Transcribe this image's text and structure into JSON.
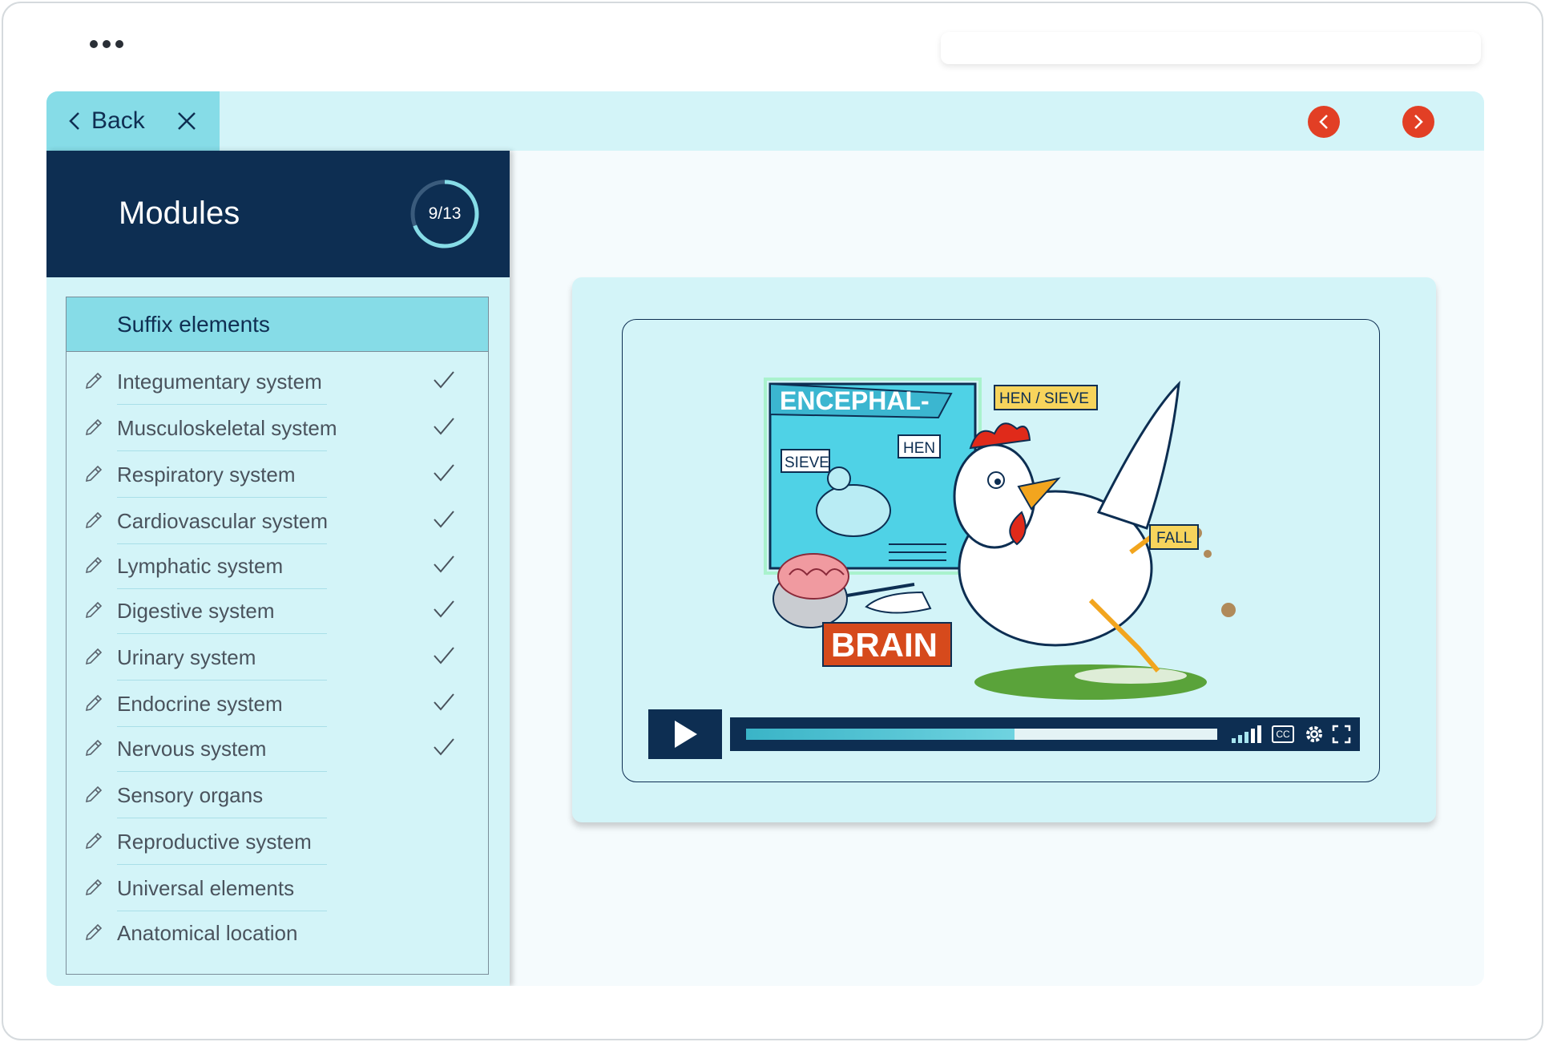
{
  "app": {
    "back_label": "Back"
  },
  "sidebar": {
    "title": "Modules",
    "progress_text": "9/13",
    "progress_fraction": 0.69,
    "section_title": "Suffix elements",
    "items": [
      {
        "label": "Integumentary system",
        "completed": true
      },
      {
        "label": "Musculoskeletal system",
        "completed": true
      },
      {
        "label": "Respiratory system",
        "completed": true
      },
      {
        "label": "Cardiovascular system",
        "completed": true
      },
      {
        "label": "Lymphatic system",
        "completed": true
      },
      {
        "label": "Digestive system",
        "completed": true
      },
      {
        "label": "Urinary system",
        "completed": true
      },
      {
        "label": "Endocrine system",
        "completed": true
      },
      {
        "label": "Nervous system",
        "completed": true
      },
      {
        "label": "Sensory organs",
        "completed": false
      },
      {
        "label": "Reproductive system",
        "completed": false
      },
      {
        "label": "Universal elements",
        "completed": false
      },
      {
        "label": "Anatomical location",
        "completed": false
      }
    ]
  },
  "video": {
    "illustration": {
      "prefix": "ENCEPHAL-",
      "sieve": "SIEVE",
      "hen": "HEN",
      "hen_sieve": "HEN / SIEVE",
      "fall": "FALL",
      "brain": "BRAIN"
    },
    "progress": 0.57,
    "cc_label": "CC"
  },
  "colors": {
    "navy": "#0d2e52",
    "accent_red": "#e23f25",
    "teal_light": "#d3f4f8",
    "teal_mid": "#86dce7"
  }
}
